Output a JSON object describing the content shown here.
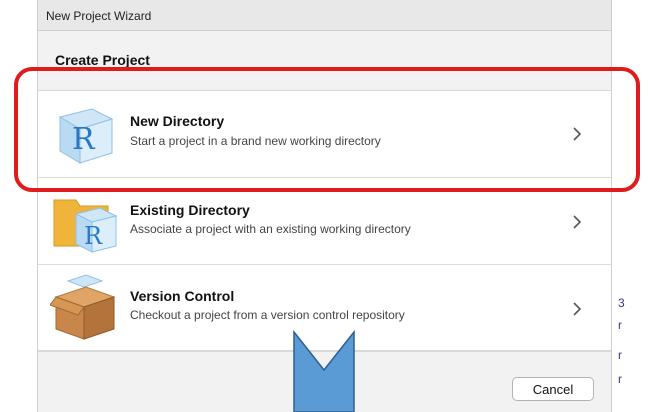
{
  "window": {
    "title": "New Project Wizard"
  },
  "section": {
    "title": "Create Project"
  },
  "options": [
    {
      "title": "New Directory",
      "description": "Start a project in a brand new working directory",
      "icon": "r-cube-icon"
    },
    {
      "title": "Existing Directory",
      "description": "Associate a project with an existing working directory",
      "icon": "folder-r-icon"
    },
    {
      "title": "Version Control",
      "description": "Checkout a project from a version control repository",
      "icon": "package-box-icon"
    }
  ],
  "footer": {
    "cancel_label": "Cancel"
  },
  "annotations": {
    "highlight_color": "#e01b1b",
    "arrow_color": "#5b9bd5"
  },
  "side_marks": [
    "3",
    "r",
    "r",
    "r"
  ]
}
